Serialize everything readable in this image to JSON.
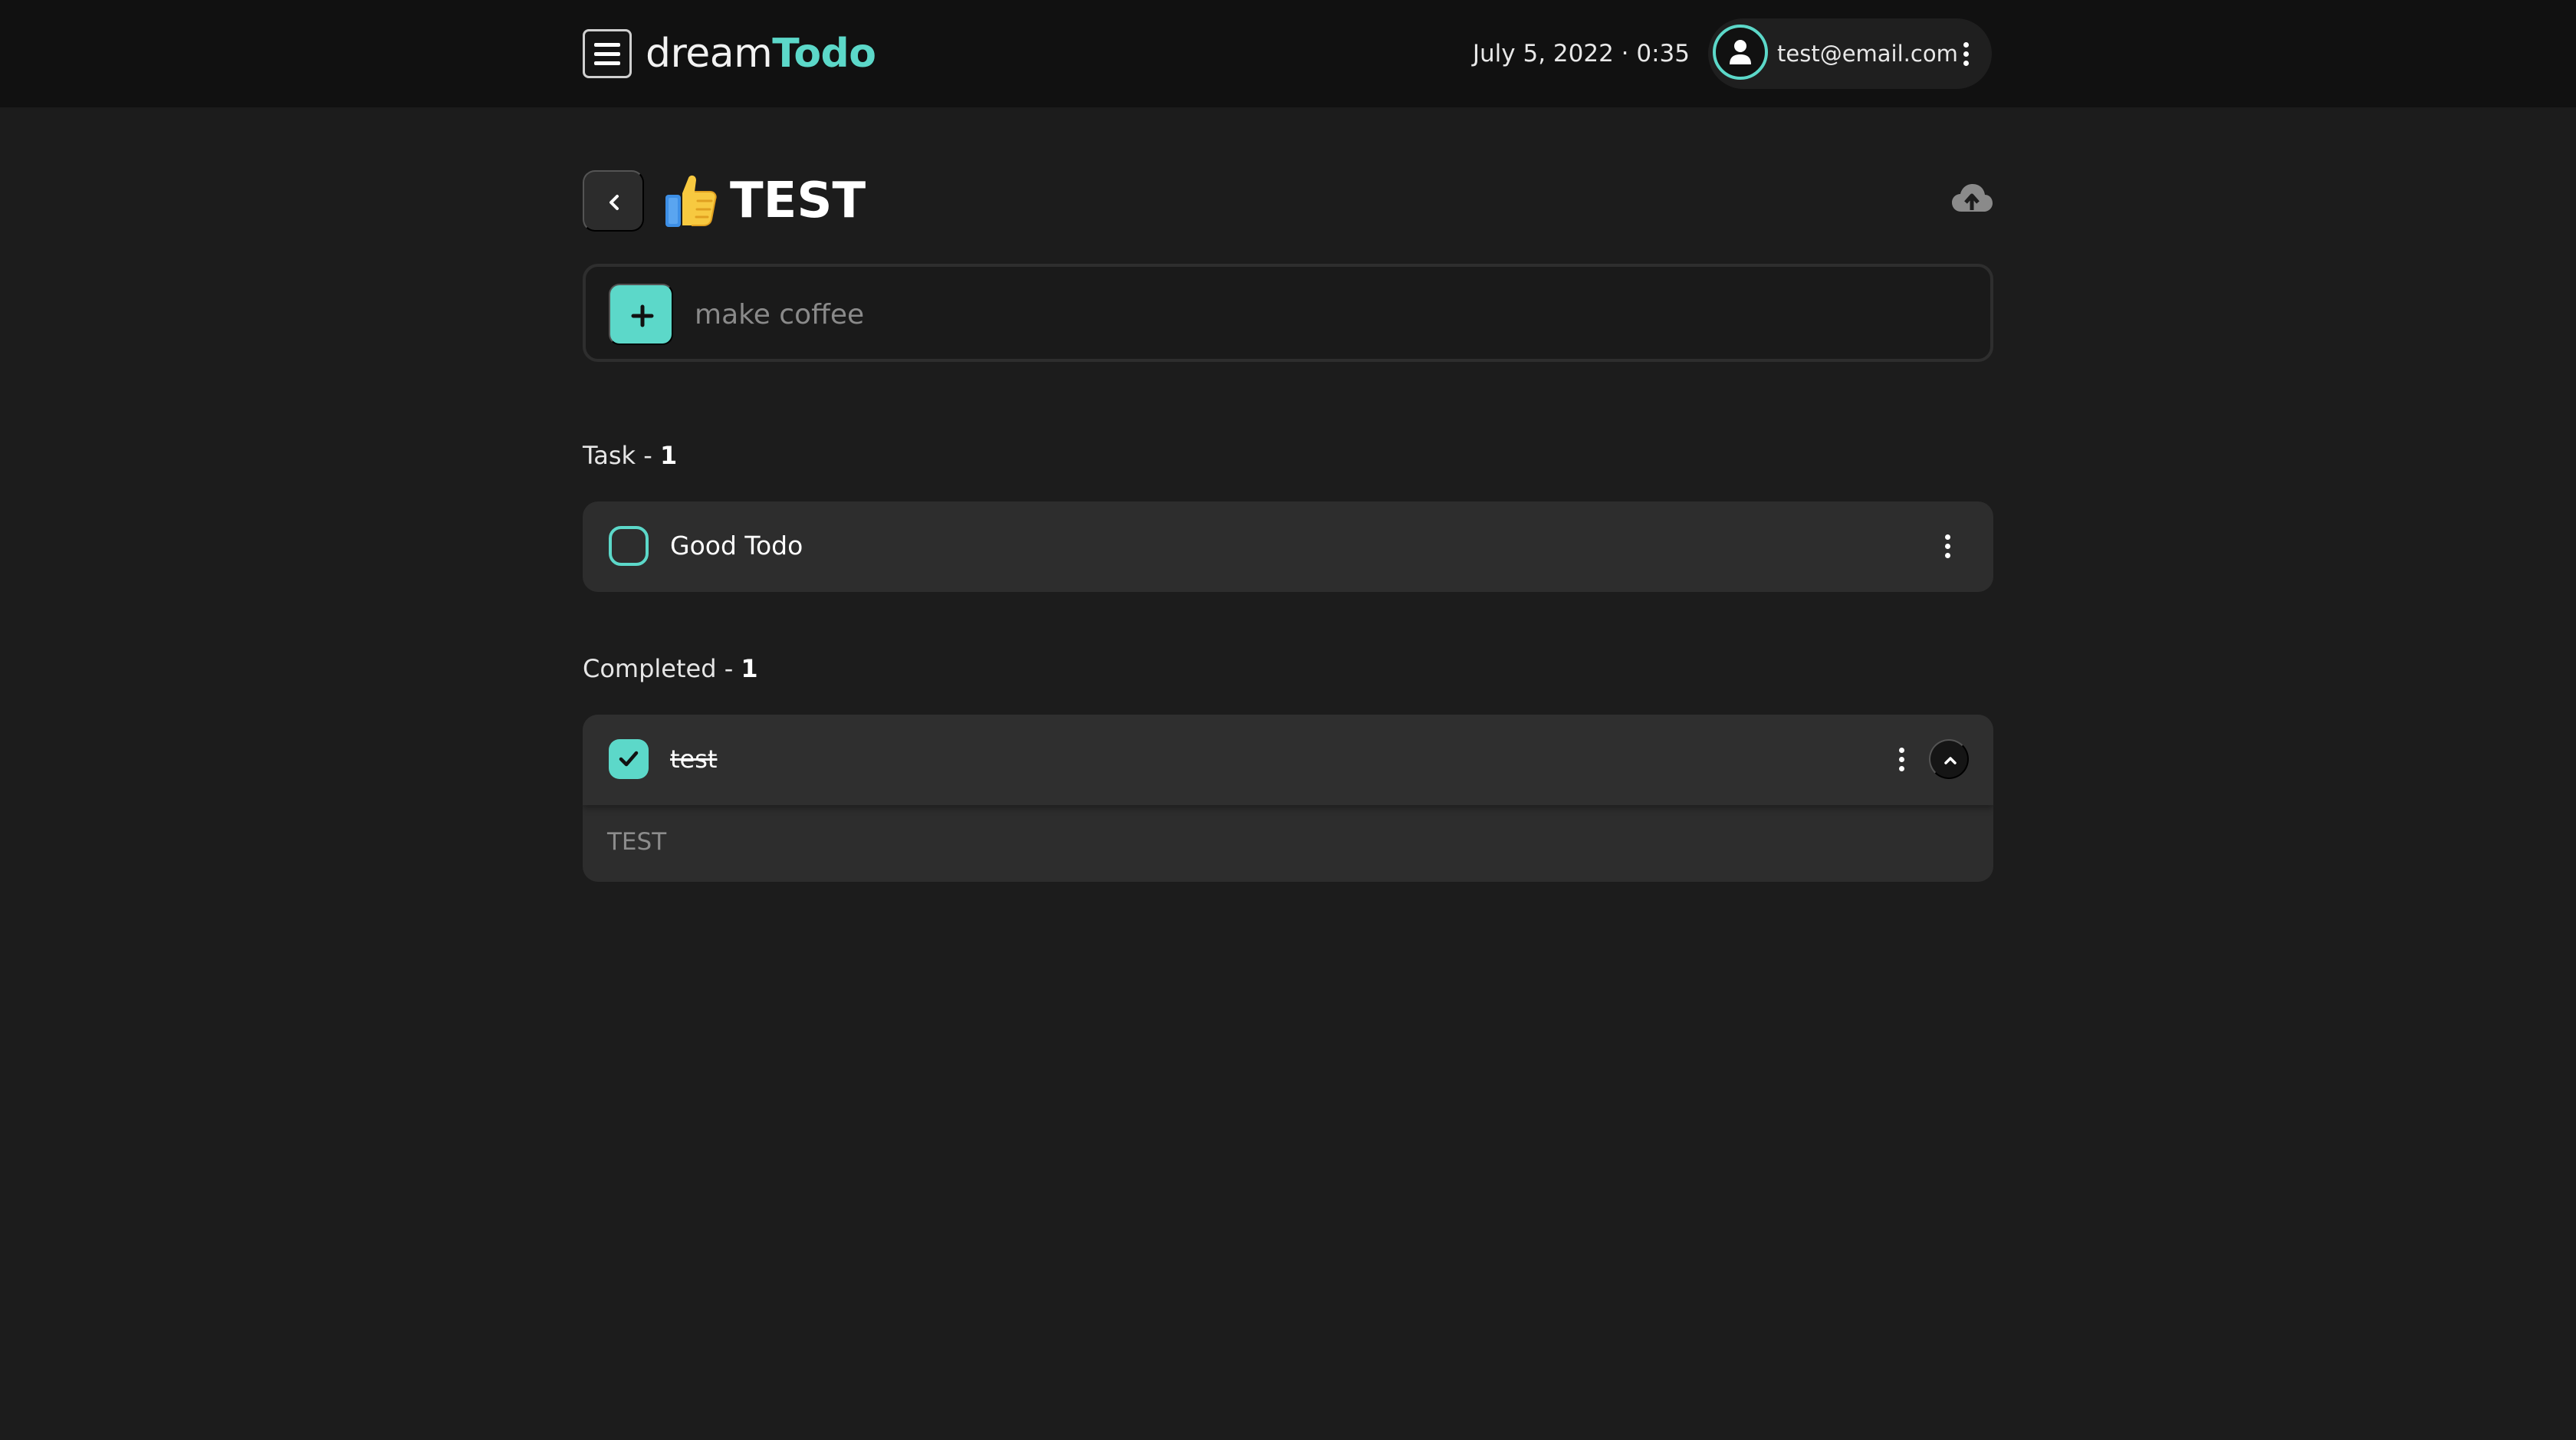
{
  "header": {
    "brand_light": "dream",
    "brand_bold": "Todo",
    "datetime": "July 5, 2022 · 0:35",
    "user_email": "test@email.com",
    "icons": {
      "menu": "hamburger-menu-icon",
      "avatar": "user-icon",
      "more": "kebab-menu-icon"
    }
  },
  "list": {
    "emoji": "👍",
    "title": "TEST",
    "icons": {
      "back": "chevron-left-icon",
      "sync": "cloud-upload-icon"
    }
  },
  "add_task": {
    "placeholder": "make coffee",
    "icon": "plus-icon"
  },
  "tasks_section": {
    "label": "Task - ",
    "count": "1",
    "items": [
      {
        "label": "Good Todo",
        "completed": false
      }
    ]
  },
  "completed_section": {
    "label": "Completed - ",
    "count": "1",
    "items": [
      {
        "label": "test",
        "completed": true,
        "note": "TEST",
        "expanded": true
      }
    ]
  },
  "colors": {
    "accent": "#5cd8c9",
    "background": "#1c1c1c",
    "header": "#111111",
    "card": "#2d2d2d"
  }
}
